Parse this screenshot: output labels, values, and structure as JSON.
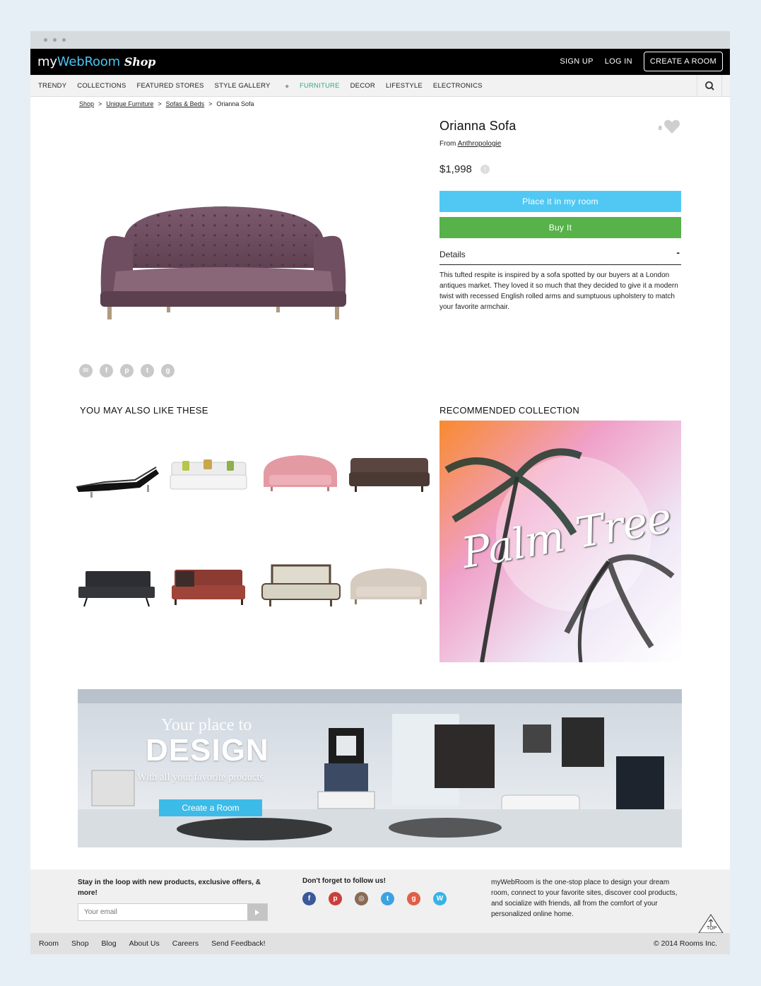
{
  "header": {
    "logo_part1": "my",
    "logo_part2": "Web",
    "logo_part3": "Room",
    "logo_part4": "Shop",
    "sign_up": "SIGN UP",
    "log_in": "LOG IN",
    "create_room": "CREATE A ROOM"
  },
  "nav": {
    "items": [
      {
        "label": "TRENDY"
      },
      {
        "label": "COLLECTIONS"
      },
      {
        "label": "FEATURED STORES"
      },
      {
        "label": "STYLE GALLERY"
      },
      {
        "label": "FURNITURE"
      },
      {
        "label": "DECOR"
      },
      {
        "label": "LIFESTYLE"
      },
      {
        "label": "ELECTRONICS"
      }
    ],
    "separator": "◆",
    "search_icon": "search-icon"
  },
  "breadcrumb": {
    "items": [
      "Shop",
      "Unique Furniture",
      "Sofas & Beds",
      "Orianna Sofa"
    ],
    "sep": ">"
  },
  "product": {
    "name": "Orianna Sofa",
    "from_label": "From",
    "store": "Anthropologie",
    "price": "$1,998",
    "likes": "8",
    "place_button": "Place it in my room",
    "buy_button": "Buy It",
    "details_label": "Details",
    "details_toggle": "-",
    "description": "This tufted respite is inspired by a sofa spotted by our buyers at a London antiques market. They loved it so much that they decided to give it a modern twist with recessed English rolled arms and sumptuous upholstery to match your favorite armchair."
  },
  "share": {
    "icons": [
      "email-icon",
      "facebook-icon",
      "pinterest-icon",
      "twitter-icon",
      "googleplus-icon"
    ]
  },
  "related": {
    "title": "YOU MAY ALSO LIKE THESE"
  },
  "collection": {
    "title": "RECOMMENDED COLLECTION",
    "image_text": "Palm Tree"
  },
  "banner": {
    "line1": "Your place to",
    "line2": "DESIGN",
    "line3": "With all your favorite products",
    "cta": "Create a Room"
  },
  "footer": {
    "newsletter": "Stay in the loop with new products, exclusive offers, & more!",
    "email_placeholder": "Your email",
    "follow": "Don't forget to follow us!",
    "about": "myWebRoom is the one-stop place to design your dream room, connect to your favorite sites, discover cool products, and socialize with friends, all from the comfort of your personalized online home.",
    "top_label": "TOP",
    "links": [
      "Room",
      "Shop",
      "Blog",
      "About Us",
      "Careers",
      "Send Feedback!"
    ],
    "copyright": "© 2014 Rooms Inc."
  },
  "colors": {
    "accent_blue": "#51c8f3",
    "buy_green": "#56b249",
    "active_nav": "#3aa87a"
  }
}
